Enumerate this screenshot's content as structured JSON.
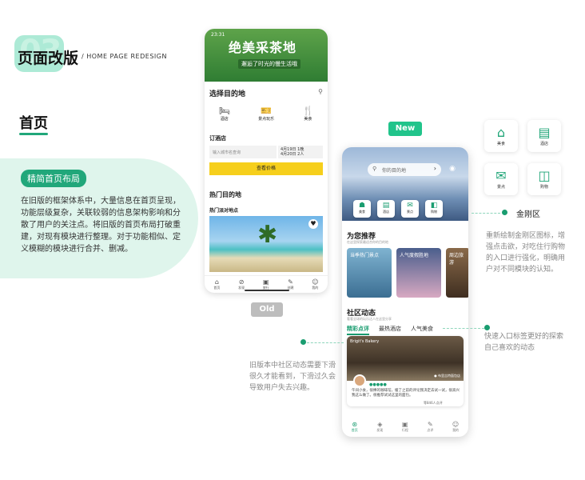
{
  "header": {
    "num": "03",
    "title": "页面改版",
    "subtitle": "/ HOME PAGE REDESIGN"
  },
  "section": {
    "title": "首页",
    "tag": "精简首页布局",
    "desc": "在旧版的框架体系中，大量信息在首页呈现，功能层级复杂，关联较弱的信息架构影响和分散了用户的关注点。将旧版的首页布局打破重建，对现有模块进行整理。对于功能相似、定义模糊的模块进行合并、删减。"
  },
  "old": {
    "label": "Old",
    "time": "23:31",
    "banner_title": "绝美采茶地",
    "banner_sub": "邂逅了时光的慢生活哦",
    "dest_title": "选择目的地",
    "icons": [
      {
        "icon": "🛏",
        "label": "酒店"
      },
      {
        "icon": "🎫",
        "label": "景点玩乐"
      },
      {
        "icon": "🍴",
        "label": "美食"
      }
    ],
    "hotel_title": "订酒店",
    "input_placeholder": "输入城市名查询",
    "date_line1": "4月19日  1晚",
    "date_line2": "4月20日  2人",
    "search_btn": "查看价格",
    "hot_title": "热门目的地",
    "hot_sub": "热门派对地点",
    "tabs": [
      {
        "icon": "⌂",
        "label": "首页"
      },
      {
        "icon": "⊘",
        "label": "发现"
      },
      {
        "icon": "▣",
        "label": "旅行"
      },
      {
        "icon": "✎",
        "label": "创建"
      },
      {
        "icon": "☺",
        "label": "我的"
      }
    ],
    "note": "旧版本中社区动态需要下滑很久才能看到，下滑过久会导致用户失去兴趣。"
  },
  "new": {
    "label": "New",
    "search_placeholder": "你的目的地",
    "kk": [
      {
        "icon": "☗",
        "label": "美食"
      },
      {
        "icon": "▤",
        "label": "酒店"
      },
      {
        "icon": "✉",
        "label": "景点"
      },
      {
        "icon": "◧",
        "label": "购物"
      }
    ],
    "rec_title": "为您推荐",
    "rec_sub": "在这里探索最适合你的目的地",
    "cards": [
      {
        "label": "当季热门景点"
      },
      {
        "label": "人气度假胜地"
      },
      {
        "label": "周边旅游"
      }
    ],
    "comm_title": "社区动态",
    "comm_sub": "看看全球的玩乐达人在这里分享",
    "comm_tabs": [
      "精彩点评",
      "最热酒店",
      "人气美食"
    ],
    "post_shop": "Brigit's Bakery",
    "post_loc": "● 布里吉特面包店",
    "post_text": "午间小食，很棒的咖啡馆，缓了之前的评论我决定去试一试，很高兴我这么做了。很推荐试试这里的面包。",
    "post_likes": "等846人点评",
    "post_stars": "●●●●●",
    "tabs": [
      {
        "icon": "⊛",
        "label": "首页"
      },
      {
        "icon": "◈",
        "label": "发现"
      },
      {
        "icon": "▣",
        "label": "行程"
      },
      {
        "icon": "✎",
        "label": "点评"
      },
      {
        "icon": "☺",
        "label": "我的"
      }
    ]
  },
  "right": {
    "icons": [
      {
        "icon": "⌂",
        "label": "美食"
      },
      {
        "icon": "▤",
        "label": "酒店"
      },
      {
        "icon": "✉",
        "label": "景点"
      },
      {
        "icon": "◫",
        "label": "购物"
      }
    ],
    "kk_label": "金刚区",
    "kk_note": "重新绘制金刚区图标，增强点击欲，对吃住行购物的入口进行强化，明确用户对不同模块的认知。",
    "tab_note": "快速入口标签更好的探索自己喜欢的动态"
  },
  "colors": {
    "accent": "#21a77a",
    "yellow": "#f6cf1c"
  }
}
